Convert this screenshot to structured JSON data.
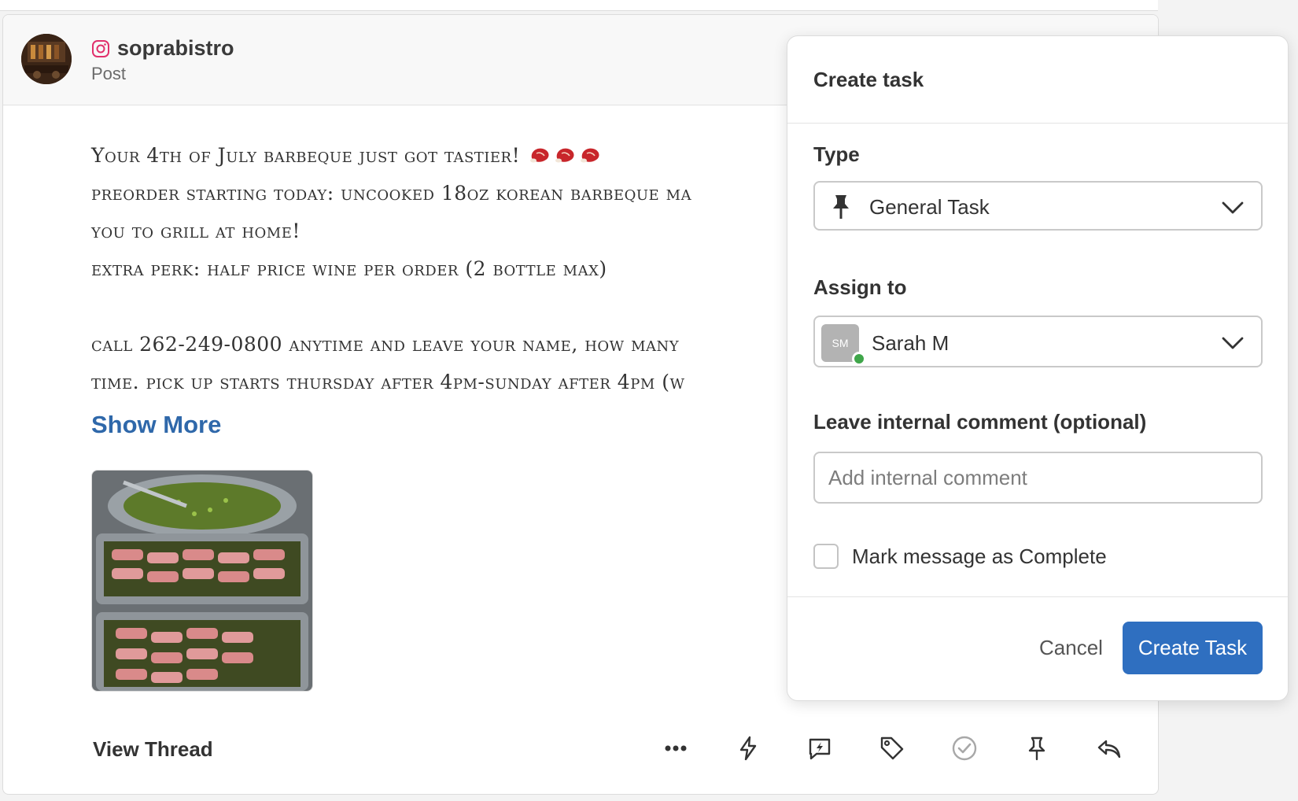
{
  "post": {
    "platform_icon": "instagram-icon",
    "username": "soprabistro",
    "type": "Post",
    "text_lines": [
      "Your 4th of July barbeque just got tastier!",
      "preorder starting today: uncooked 18oz korean barbeque ma",
      "you to grill at home!",
      "extra perk: half price wine per order (2 bottle max)",
      "",
      "call 262-249-0800 anytime and leave your name, how many",
      "time. pick up starts thursday after 4pm-sunday after 4pm (w"
    ],
    "emoji": "meat-emoji",
    "show_more": "Show More",
    "view_thread": "View Thread"
  },
  "actions": [
    {
      "name": "more-options-icon"
    },
    {
      "name": "lightning-icon"
    },
    {
      "name": "quick-reply-icon"
    },
    {
      "name": "tag-icon"
    },
    {
      "name": "complete-check-icon"
    },
    {
      "name": "pin-icon"
    },
    {
      "name": "reply-icon"
    }
  ],
  "modal": {
    "title": "Create task",
    "type_label": "Type",
    "type_value": "General Task",
    "assign_label": "Assign to",
    "assignee_initials": "SM",
    "assignee_name": "Sarah M",
    "comment_label": "Leave internal comment (optional)",
    "comment_placeholder": "Add internal comment",
    "comment_value": "",
    "complete_label": "Mark message as Complete",
    "complete_checked": false,
    "cancel_label": "Cancel",
    "create_label": "Create Task"
  },
  "colors": {
    "link": "#2f68aa",
    "primary_button": "#2f6fc0",
    "online": "#3fa64a",
    "instagram": "#e1306c"
  }
}
